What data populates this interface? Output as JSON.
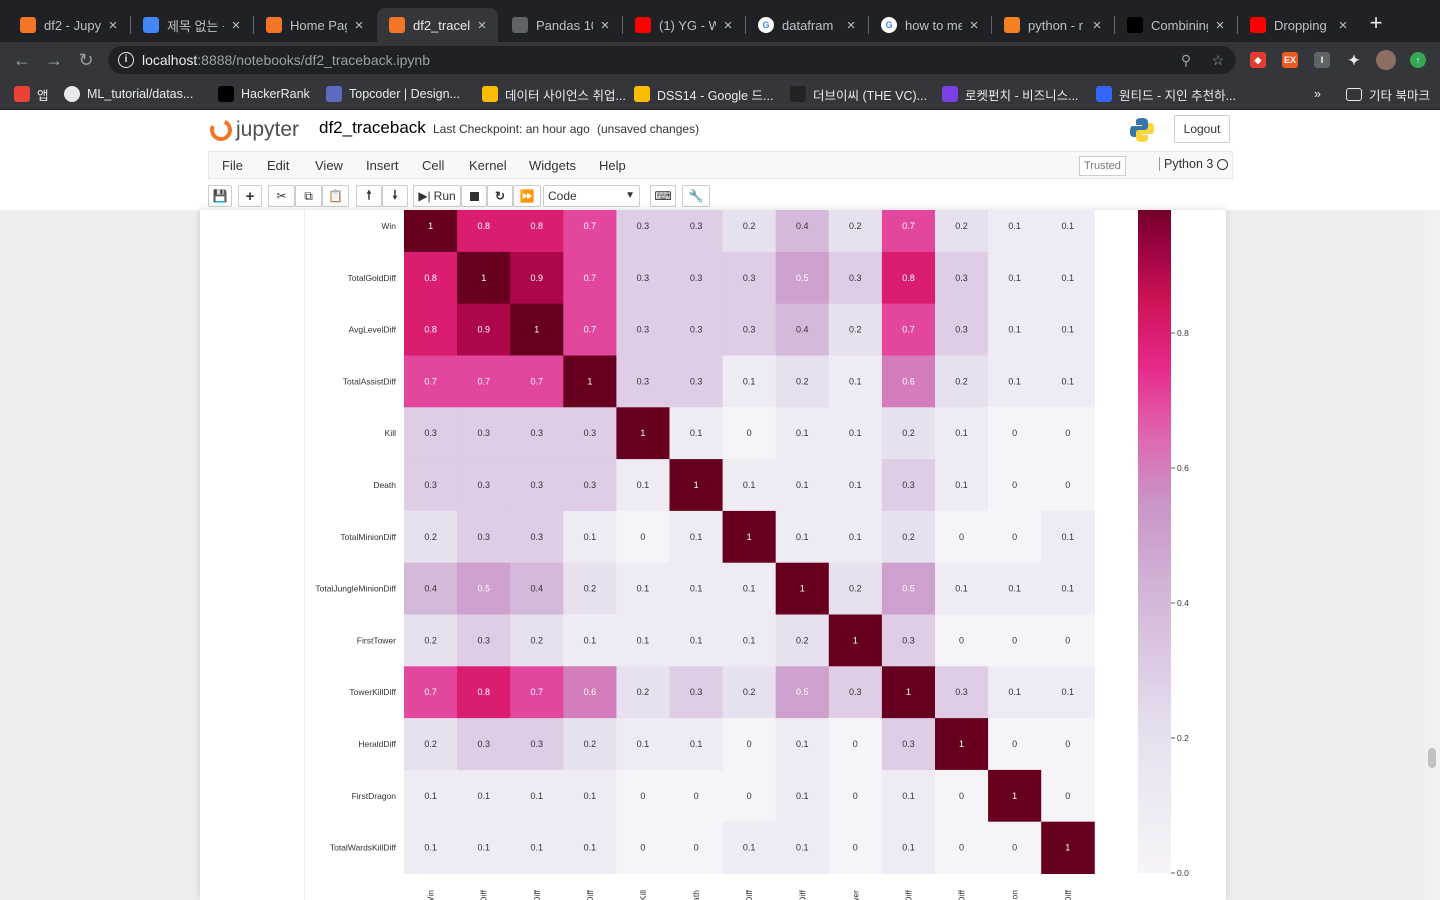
{
  "browser": {
    "tabs": [
      {
        "title": "df2 - Jupy",
        "icon": "jupyter-icon",
        "color": "#f37626",
        "active": false
      },
      {
        "title": "제목 없는 문",
        "icon": "google-docs-icon",
        "color": "#4285f4",
        "active": false
      },
      {
        "title": "Home Pag",
        "icon": "jupyter-icon",
        "color": "#f37626",
        "active": false
      },
      {
        "title": "df2_tracel",
        "icon": "jupyter-icon",
        "color": "#f37626",
        "active": true
      },
      {
        "title": "Pandas 10",
        "icon": "globe-icon",
        "color": "#5f6368",
        "active": false
      },
      {
        "title": "(1) YG - W",
        "icon": "youtube-icon",
        "color": "#ff0000",
        "active": false
      },
      {
        "title": "datafram",
        "icon": "google-icon",
        "color": "#ffffff",
        "active": false
      },
      {
        "title": "how to me",
        "icon": "google-icon",
        "color": "#ffffff",
        "active": false
      },
      {
        "title": "python - r",
        "icon": "stackoverflow-icon",
        "color": "#f48024",
        "active": false
      },
      {
        "title": "Combining",
        "icon": "dev-icon",
        "color": "#000000",
        "active": false
      },
      {
        "title": "Dropping",
        "icon": "red-square-icon",
        "color": "#ff0000",
        "active": false
      }
    ],
    "url_host": "localhost",
    "url_path": ":8888/notebooks/df2_traceback.ipynb",
    "bookmarks": [
      {
        "label": "앱",
        "icon": "apps-grid-icon"
      },
      {
        "label": "ML_tutorial/datas...",
        "icon": "github-icon"
      },
      {
        "label": "HackerRank",
        "icon": "hackerrank-icon"
      },
      {
        "label": "Topcoder | Design...",
        "icon": "topcoder-icon"
      },
      {
        "label": "데이터 사이언스 취업...",
        "icon": "google-drive-icon"
      },
      {
        "label": "DSS14 - Google 드...",
        "icon": "google-drive-icon"
      },
      {
        "label": "더브이씨 (THE VC)...",
        "icon": "thevc-icon"
      },
      {
        "label": "로켓펀치 - 비즈니스...",
        "icon": "rocketpunch-icon"
      },
      {
        "label": "원티드 - 지인 추천하...",
        "icon": "wanted-icon"
      }
    ],
    "bookmarks_overflow": "»",
    "other_bookmarks": "기타 북마크"
  },
  "jupyter": {
    "logo_text": "jupyter",
    "notebook_name": "df2_traceback",
    "checkpoint": "Last Checkpoint: an hour ago",
    "unsaved": "(unsaved changes)",
    "logout": "Logout",
    "menu": [
      "File",
      "Edit",
      "View",
      "Insert",
      "Cell",
      "Kernel",
      "Widgets",
      "Help"
    ],
    "trusted": "Trusted",
    "kernel_name": "Python 3",
    "run_label": "Run",
    "cell_type": "Code"
  },
  "chart_data": {
    "type": "heatmap",
    "rows": [
      "Win",
      "TotalGoldDiff",
      "AvgLevelDiff",
      "TotalAssistDiff",
      "Kill",
      "Death",
      "TotalMinionDiff",
      "TotalJungleMinionDiff",
      "FirstTower",
      "TowerKillDiff",
      "HeraldDiff",
      "FirstDragon",
      "TotalWardsKillDiff"
    ],
    "col_labels_visible": [
      "Win",
      "dDiff",
      "elDiff",
      "stDiff",
      "Kill",
      "eath",
      "nDiff",
      "nDiff",
      "ower",
      "illDiff",
      "dDiff",
      "agon",
      "illDiff"
    ],
    "values": [
      [
        1,
        0.8,
        0.8,
        0.7,
        0.3,
        0.3,
        0.2,
        0.4,
        0.2,
        0.7,
        0.2,
        0.1,
        0.1
      ],
      [
        0.8,
        1,
        0.9,
        0.7,
        0.3,
        0.3,
        0.3,
        0.5,
        0.3,
        0.8,
        0.3,
        0.1,
        0.1
      ],
      [
        0.8,
        0.9,
        1,
        0.7,
        0.3,
        0.3,
        0.3,
        0.4,
        0.2,
        0.7,
        0.3,
        0.1,
        0.1
      ],
      [
        0.7,
        0.7,
        0.7,
        1,
        0.3,
        0.3,
        0.1,
        0.2,
        0.1,
        0.6,
        0.2,
        0.1,
        0.1
      ],
      [
        0.3,
        0.3,
        0.3,
        0.3,
        1,
        0.1,
        0,
        0.1,
        0.1,
        0.2,
        0.1,
        0,
        0
      ],
      [
        0.3,
        0.3,
        0.3,
        0.3,
        0.1,
        1,
        0.1,
        0.1,
        0.1,
        0.3,
        0.1,
        0,
        0
      ],
      [
        0.2,
        0.3,
        0.3,
        0.1,
        0,
        0.1,
        1,
        0.1,
        0.1,
        0.2,
        0,
        0,
        0.1
      ],
      [
        0.4,
        0.5,
        0.4,
        0.2,
        0.1,
        0.1,
        0.1,
        1,
        0.2,
        0.5,
        0.1,
        0.1,
        0.1
      ],
      [
        0.2,
        0.3,
        0.2,
        0.1,
        0.1,
        0.1,
        0.1,
        0.2,
        1,
        0.3,
        0,
        0,
        0
      ],
      [
        0.7,
        0.8,
        0.7,
        0.6,
        0.2,
        0.3,
        0.2,
        0.5,
        0.3,
        1,
        0.3,
        0.1,
        0.1
      ],
      [
        0.2,
        0.3,
        0.3,
        0.2,
        0.1,
        0.1,
        0,
        0.1,
        0,
        0.3,
        1,
        0,
        0
      ],
      [
        0.1,
        0.1,
        0.1,
        0.1,
        0,
        0,
        0,
        0.1,
        0,
        0.1,
        0,
        1,
        0
      ],
      [
        0.1,
        0.1,
        0.1,
        0.1,
        0,
        0,
        0.1,
        0.1,
        0,
        0.1,
        0,
        0,
        1
      ]
    ],
    "colorbar_ticks": [
      "0.0",
      "0.2",
      "0.4",
      "0.6",
      "0.8"
    ],
    "vmin": 0,
    "vmax": 1,
    "colormap": "PuRd",
    "colors": {
      "low": "#f7f4f9",
      "mid1": "#d4b9da",
      "mid2": "#df65b0",
      "mid3": "#e7298a",
      "high": "#67001f"
    }
  }
}
